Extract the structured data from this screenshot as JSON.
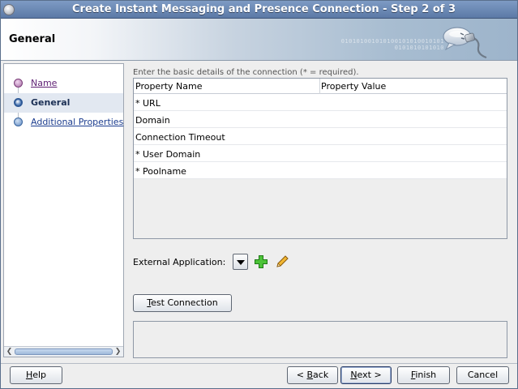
{
  "window": {
    "title": "Create Instant Messaging and Presence Connection - Step 2 of 3"
  },
  "header": {
    "page_title": "General",
    "binary_text": "010101001010100101010010101\n0101010101010"
  },
  "nav": {
    "items": [
      {
        "label": "Name",
        "state": "done"
      },
      {
        "label": "General",
        "state": "active"
      },
      {
        "label": "Additional Properties",
        "state": "pending"
      }
    ]
  },
  "main": {
    "intro": "Enter the basic details of the connection (* = required).",
    "grid": {
      "columns": [
        "Property Name",
        "Property Value"
      ],
      "rows": [
        {
          "name": "* URL",
          "value": ""
        },
        {
          "name": "Domain",
          "value": ""
        },
        {
          "name": "Connection Timeout",
          "value": ""
        },
        {
          "name": "* User Domain",
          "value": ""
        },
        {
          "name": "* Poolname",
          "value": ""
        }
      ]
    },
    "external_application_label": "External Application:",
    "external_application_value": "",
    "test_connection": {
      "mnemonic": "T",
      "rest": "est Connection"
    }
  },
  "footer": {
    "help": {
      "mnemonic": "H",
      "rest": "elp"
    },
    "back": {
      "prefix": "< ",
      "mnemonic": "B",
      "rest": "ack"
    },
    "next": {
      "mnemonic": "N",
      "rest": "ext >"
    },
    "finish": {
      "mnemonic": "F",
      "rest": "inish"
    },
    "cancel": {
      "label": "Cancel"
    }
  },
  "colors": {
    "title_bar": "#5b79a6",
    "active_nav": "#e2e8f1",
    "link": "#1c3d8f",
    "visited_link": "#5e1f73",
    "add_icon": "#3cae2a",
    "edit_icon": "#e0a526"
  },
  "icons": [
    "app-icon",
    "chat-bubble-icon",
    "dropdown-arrow-icon",
    "add-icon",
    "edit-pencil-icon"
  ]
}
